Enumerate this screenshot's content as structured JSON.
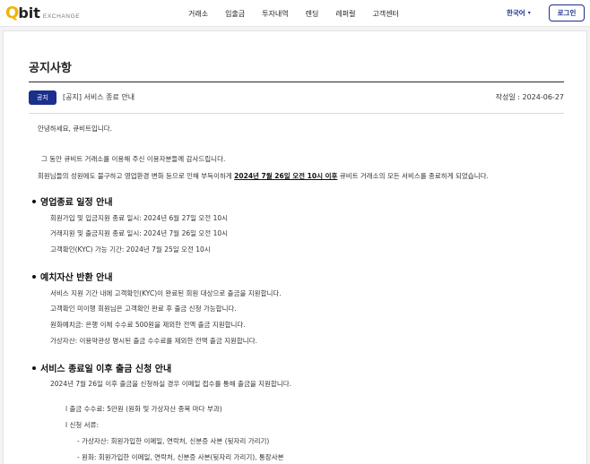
{
  "header": {
    "logo": {
      "q": "Q",
      "bit": "bit",
      "exchange": "EXCHANGE"
    },
    "nav": [
      "거래소",
      "입출금",
      "투자내역",
      "렌딩",
      "레퍼럴",
      "고객센터"
    ],
    "lang": "한국어",
    "login": "로그인"
  },
  "page": {
    "title": "공지사항",
    "badge": "공지",
    "notice_title": "[공지] 서비스 종료 안내",
    "date": "작성일 : 2024-06-27"
  },
  "content": {
    "greeting": "안녕하세요, 큐비트입니다.",
    "thanks": "그 동안 큐비트 거래소를 이용해 주신 이용자분들께 감사드립니다.",
    "intro_pre": "회원님들의 성원에도 불구하고 영업환경 변화 등으로 인해 부득이하게 ",
    "intro_bold": "2024년 7월 26일 오전 10시 이후",
    "intro_post": " 큐비트 거래소의 모든 서비스를 종료하게 되었습니다.",
    "s1_title": "영업종료 일정 안내",
    "s1_l1": "회원가입 및 입금지원 종료 일시: 2024년 6월 27일 오전 10시",
    "s1_l2": "거래지원 및 출금지원 종료 일시: 2024년 7월 26일 오전 10시",
    "s1_l3": "고객확인(KYC) 가능 기간: 2024년 7월 25일 오전 10시",
    "s2_title": "예치자산 반환 안내",
    "s2_l1": "서비스 지원 기간 내에 고객확인(KYC)이 완료된 회원 대상으로 출금을 지원합니다.",
    "s2_l2": "고객확인 미이행 회원님은 고객확인 완료 후 출금 신청 가능합니다.",
    "s2_l3": "원화예치금: 은행 이체 수수료 500원을 제외한 전액 출금 지원합니다.",
    "s2_l4": "가상자산: 이용약관상 명시된 출금 수수료를 제외한 전액 출금 지원합니다.",
    "s3_title": "서비스 종료일 이후 출금 신청 안내",
    "s3_l1": "2024년 7월 26일 이후 출금을 신청하실 경우 이메일 접수를 통해 출금을 지원합니다.",
    "s3_fee": "l 출금 수수료: 5만원 (원화 및 가상자산 종목 마다 부과)",
    "s3_docs": "l 신청 서류:",
    "s3_d1": "- 가상자산: 회원가입한 이메일, 연락처, 신분증 사본 (뒷자리 가리기)",
    "s3_d2": "- 원화: 회원가입한 이메일, 연락처, 신분증 사본(뒷자리 가리기), 통장사본"
  }
}
